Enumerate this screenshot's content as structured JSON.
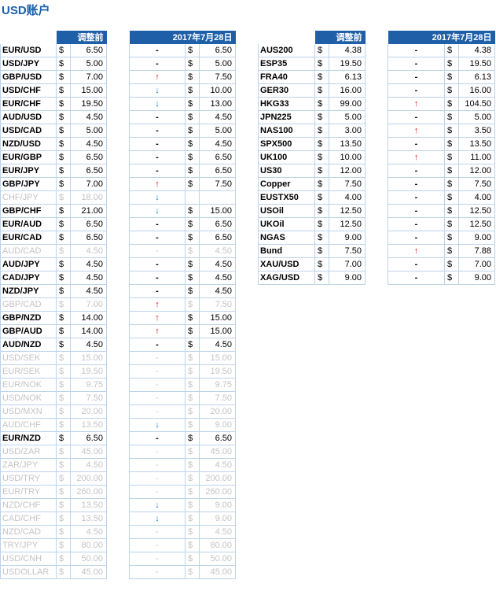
{
  "title": "USD账户",
  "headers": {
    "before": "调整前",
    "date": "2017年7月28日"
  },
  "usd_table": [
    {
      "pair": "EUR/USD",
      "before": "6.50",
      "change": "-",
      "after": "6.50",
      "dim": false
    },
    {
      "pair": "USD/JPY",
      "before": "5.00",
      "change": "-",
      "after": "5.00",
      "dim": false
    },
    {
      "pair": "GBP/USD",
      "before": "7.00",
      "change": "up",
      "after": "7.50",
      "dim": false
    },
    {
      "pair": "USD/CHF",
      "before": "15.00",
      "change": "down",
      "after": "10.00",
      "dim": false
    },
    {
      "pair": "EUR/CHF",
      "before": "19.50",
      "change": "down",
      "after": "13.00",
      "dim": false
    },
    {
      "pair": "AUD/USD",
      "before": "4.50",
      "change": "-",
      "after": "4.50",
      "dim": false
    },
    {
      "pair": "USD/CAD",
      "before": "5.00",
      "change": "-",
      "after": "5.00",
      "dim": false
    },
    {
      "pair": "NZD/USD",
      "before": "4.50",
      "change": "-",
      "after": "4.50",
      "dim": false
    },
    {
      "pair": "EUR/GBP",
      "before": "6.50",
      "change": "-",
      "after": "6.50",
      "dim": false
    },
    {
      "pair": "EUR/JPY",
      "before": "6.50",
      "change": "-",
      "after": "6.50",
      "dim": false
    },
    {
      "pair": "GBP/JPY",
      "before": "7.00",
      "change": "up",
      "after": "7.50",
      "dim": false
    },
    {
      "pair": "CHF/JPY",
      "before": "18.00",
      "change": "down",
      "after": "",
      "dim": true
    },
    {
      "pair": "GBP/CHF",
      "before": "21.00",
      "change": "down",
      "after": "15.00",
      "dim": false
    },
    {
      "pair": "EUR/AUD",
      "before": "6.50",
      "change": "-",
      "after": "6.50",
      "dim": false
    },
    {
      "pair": "EUR/CAD",
      "before": "6.50",
      "change": "-",
      "after": "6.50",
      "dim": false
    },
    {
      "pair": "AUD/CAD",
      "before": "4.50",
      "change": "-",
      "after": "4.50",
      "dim": true
    },
    {
      "pair": "AUD/JPY",
      "before": "4.50",
      "change": "-",
      "after": "4.50",
      "dim": false
    },
    {
      "pair": "CAD/JPY",
      "before": "4.50",
      "change": "-",
      "after": "4.50",
      "dim": false
    },
    {
      "pair": "NZD/JPY",
      "before": "4.50",
      "change": "-",
      "after": "4.50",
      "dim": false
    },
    {
      "pair": "GBP/CAD",
      "before": "7.00",
      "change": "up",
      "after": "7.50",
      "dim": true
    },
    {
      "pair": "GBP/NZD",
      "before": "14.00",
      "change": "up",
      "after": "15.00",
      "dim": false
    },
    {
      "pair": "GBP/AUD",
      "before": "14.00",
      "change": "up",
      "after": "15.00",
      "dim": false
    },
    {
      "pair": "AUD/NZD",
      "before": "4.50",
      "change": "-",
      "after": "4.50",
      "dim": false
    },
    {
      "pair": "USD/SEK",
      "before": "15.00",
      "change": "-",
      "after": "15.00",
      "dim": true
    },
    {
      "pair": "EUR/SEK",
      "before": "19.50",
      "change": "-",
      "after": "19.50",
      "dim": true
    },
    {
      "pair": "EUR/NOK",
      "before": "9.75",
      "change": "-",
      "after": "9.75",
      "dim": true
    },
    {
      "pair": "USD/NOK",
      "before": "7.50",
      "change": "-",
      "after": "7.50",
      "dim": true
    },
    {
      "pair": "USD/MXN",
      "before": "20.00",
      "change": "-",
      "after": "20.00",
      "dim": true
    },
    {
      "pair": "AUD/CHF",
      "before": "13.50",
      "change": "down",
      "after": "9.00",
      "dim": true
    },
    {
      "pair": "EUR/NZD",
      "before": "6.50",
      "change": "-",
      "after": "6.50",
      "dim": false
    },
    {
      "pair": "USD/ZAR",
      "before": "45.00",
      "change": "-",
      "after": "45.00",
      "dim": true
    },
    {
      "pair": "ZAR/JPY",
      "before": "4.50",
      "change": "-",
      "after": "4.50",
      "dim": true
    },
    {
      "pair": "USD/TRY",
      "before": "200.00",
      "change": "-",
      "after": "200.00",
      "dim": true
    },
    {
      "pair": "EUR/TRY",
      "before": "260.00",
      "change": "-",
      "after": "260.00",
      "dim": true
    },
    {
      "pair": "NZD/CHF",
      "before": "13.50",
      "change": "down",
      "after": "9.00",
      "dim": true
    },
    {
      "pair": "CAD/CHF",
      "before": "13.50",
      "change": "down",
      "after": "9.00",
      "dim": true
    },
    {
      "pair": "NZD/CAD",
      "before": "4.50",
      "change": "-",
      "after": "4.50",
      "dim": true
    },
    {
      "pair": "TRY/JPY",
      "before": "80.00",
      "change": "-",
      "after": "80.00",
      "dim": true
    },
    {
      "pair": "USD/CNH",
      "before": "50.00",
      "change": "-",
      "after": "50.00",
      "dim": true
    },
    {
      "pair": "USDOLLAR",
      "before": "45.00",
      "change": "-",
      "after": "45.00",
      "dim": true
    }
  ],
  "cfd_table": [
    {
      "pair": "AUS200",
      "before": "4.38",
      "change": "-",
      "after": "4.38",
      "dim": false
    },
    {
      "pair": "ESP35",
      "before": "19.50",
      "change": "-",
      "after": "19.50",
      "dim": false
    },
    {
      "pair": "FRA40",
      "before": "6.13",
      "change": "-",
      "after": "6.13",
      "dim": false
    },
    {
      "pair": "GER30",
      "before": "16.00",
      "change": "-",
      "after": "16.00",
      "dim": false
    },
    {
      "pair": "HKG33",
      "before": "99.00",
      "change": "up",
      "after": "104.50",
      "dim": false
    },
    {
      "pair": "JPN225",
      "before": "5.00",
      "change": "-",
      "after": "5.00",
      "dim": false
    },
    {
      "pair": "NAS100",
      "before": "3.00",
      "change": "up",
      "after": "3.50",
      "dim": false
    },
    {
      "pair": "SPX500",
      "before": "13.50",
      "change": "-",
      "after": "13.50",
      "dim": false
    },
    {
      "pair": "UK100",
      "before": "10.00",
      "change": "up",
      "after": "11.00",
      "dim": false
    },
    {
      "pair": "US30",
      "before": "12.00",
      "change": "-",
      "after": "12.00",
      "dim": false
    },
    {
      "pair": "Copper",
      "before": "7.50",
      "change": "-",
      "after": "7.50",
      "dim": false
    },
    {
      "pair": "EUSTX50",
      "before": "4.00",
      "change": "-",
      "after": "4.00",
      "dim": false
    },
    {
      "pair": "USOil",
      "before": "12.50",
      "change": "-",
      "after": "12.50",
      "dim": false
    },
    {
      "pair": "UKOil",
      "before": "12.50",
      "change": "-",
      "after": "12.50",
      "dim": false
    },
    {
      "pair": "NGAS",
      "before": "9.00",
      "change": "-",
      "after": "9.00",
      "dim": false
    },
    {
      "pair": "Bund",
      "before": "7.50",
      "change": "up",
      "after": "7.88",
      "dim": false
    },
    {
      "pair": "XAU/USD",
      "before": "7.00",
      "change": "-",
      "after": "7.00",
      "dim": false
    },
    {
      "pair": "XAG/USD",
      "before": "9.00",
      "change": "-",
      "after": "9.00",
      "dim": false
    }
  ]
}
